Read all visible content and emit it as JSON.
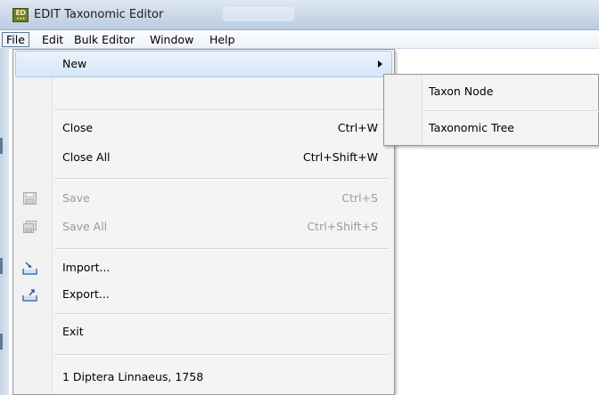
{
  "window": {
    "title": "EDIT Taxonomic Editor",
    "icon_name": "edit-app-icon",
    "icon_text": "ED"
  },
  "menubar": {
    "items": [
      {
        "label": "File",
        "active": true
      },
      {
        "label": "Edit"
      },
      {
        "label": "Bulk Editor"
      },
      {
        "label": "Window"
      },
      {
        "label": "Help"
      }
    ]
  },
  "file_menu": {
    "new": {
      "label": "New"
    },
    "close": {
      "label": "Close",
      "shortcut": "Ctrl+W"
    },
    "close_all": {
      "label": "Close All",
      "shortcut": "Ctrl+Shift+W"
    },
    "save": {
      "label": "Save",
      "shortcut": "Ctrl+S",
      "disabled": true
    },
    "save_all": {
      "label": "Save All",
      "shortcut": "Ctrl+Shift+S",
      "disabled": true
    },
    "import": {
      "label": "Import..."
    },
    "export": {
      "label": "Export..."
    },
    "exit": {
      "label": "Exit"
    },
    "recent_1": {
      "label": "1 Diptera Linnaeus, 1758"
    }
  },
  "new_submenu": {
    "items": [
      {
        "label": "Taxon Node"
      },
      {
        "label": "Taxonomic Tree"
      }
    ]
  },
  "colors": {
    "highlight": "#d7e6f8",
    "menu_bg": "#f4f4f4",
    "disabled_text": "#9a9a9a"
  }
}
